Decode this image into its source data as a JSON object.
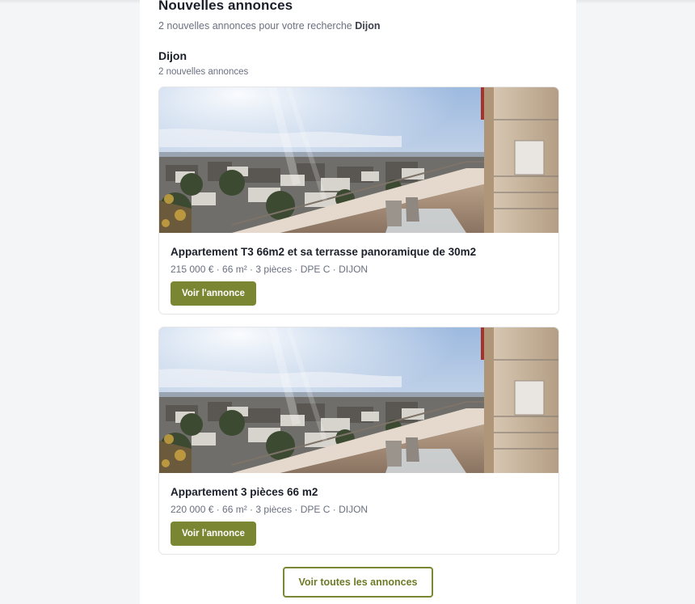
{
  "header": {
    "title": "Nouvelles annonces",
    "intro_prefix": "2 nouvelles annonces pour votre recherche",
    "intro_search": "Dijon"
  },
  "city_group": {
    "name": "Dijon",
    "count_label": "2 nouvelles annonces"
  },
  "listings": [
    {
      "title": "Appartement T3 66m2 et sa terrasse panoramique de 30m2",
      "meta": "215 000 € · 66 m² · 3 pièces · DPE C · DIJON",
      "button_label": "Voir l'annonce"
    },
    {
      "title": "Appartement 3 pièces 66 m2",
      "meta": "220 000 € · 66 m² · 3 pièces · DPE C · DIJON",
      "button_label": "Voir l'annonce"
    }
  ],
  "footer": {
    "all_listings_label": "Voir toutes les annonces"
  },
  "colors": {
    "accent": "#7a8632",
    "page_background": "#f4f5f7",
    "card_background": "#ffffff",
    "muted_text": "#6b7080"
  }
}
